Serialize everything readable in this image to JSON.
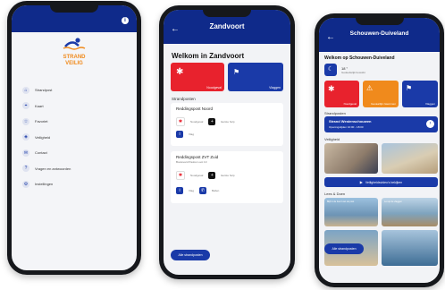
{
  "colors": {
    "navy": "#0f2a8a",
    "red": "#e8222d",
    "orange": "#f08a1c",
    "blue": "#1a3aa8"
  },
  "phone1": {
    "logo_line1": "STRAND",
    "logo_line2": "VEILIG",
    "menu": [
      "Strandpost",
      "Kaart",
      "Favoriet",
      "Veiligheid",
      "Contact",
      "Vragen en antwoorden",
      "Instellingen"
    ]
  },
  "phone2": {
    "title": "Zandvoort",
    "welcome": "Welkom in Zandvoort",
    "tile1": "Noodgeval",
    "tile2": "Vlaggen",
    "section": "Strandposten",
    "post1": {
      "name": "Reddingspost Noord",
      "a": "Noodgeval",
      "b": "Eerste hulp",
      "c": "Vlag"
    },
    "post2": {
      "name": "Reddingspost ZVT Zuid",
      "sub": "Boulevard Paulus Loot 10",
      "a": "Noodgeval",
      "b": "Eerste hulp",
      "c": "Vlag",
      "d": "Bellen"
    },
    "button": "Alle strandposten"
  },
  "phone3": {
    "title": "Schouwen-Duiveland",
    "welcome": "Welkom op Schouwen-Duiveland",
    "temp": "18 °",
    "temp_sub": "Gedeeltelijk bewolkt",
    "tile1": "Noodgeval",
    "tile2": "Gevaarlijk zwemmen",
    "tile3": "Vlaggen",
    "section1": "Strandposten",
    "post_name": "Strand Westenschouwen",
    "post_sub": "Openingstijden 10:00 - 18:00",
    "section2": "Veiligheid",
    "video_btn": "Veiligheidsvideo's bekijken",
    "section3": "Lees & Doen",
    "b1": "Blijf in de buurt van de post",
    "b2": "Let op de vlaggen",
    "float_btn": "Alle strandposten"
  }
}
